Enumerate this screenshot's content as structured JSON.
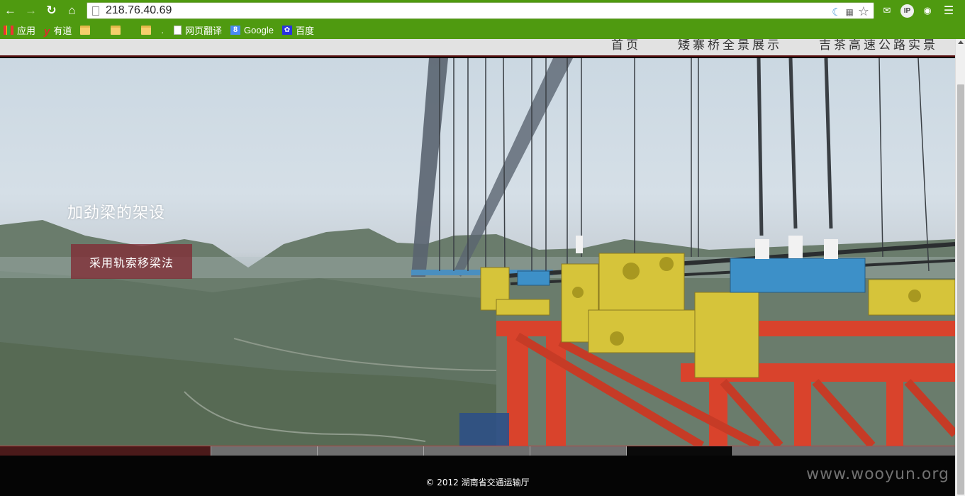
{
  "browser": {
    "url": "218.76.40.69",
    "bookmarks": [
      {
        "label": "应用",
        "icon": "apps-grid-icon"
      },
      {
        "label": "有道",
        "icon": "youdao-icon"
      },
      {
        "label": "",
        "icon": "folder-icon"
      },
      {
        "label": "",
        "icon": "folder-icon"
      },
      {
        "label": ".",
        "icon": "folder-icon"
      },
      {
        "label": "网页翻译",
        "icon": "page-icon"
      },
      {
        "label": "Google",
        "icon": "google-icon"
      },
      {
        "label": "百度",
        "icon": "baidu-icon"
      }
    ]
  },
  "site": {
    "nav": [
      "首页",
      "矮寨桥全景展示",
      "吉茶高速公路实景"
    ],
    "slide": {
      "title": "加劲梁的架设",
      "button_label": "采用轨索移梁法"
    },
    "pager": {
      "count": 7,
      "active_index": 5
    },
    "footer": {
      "copyright": "© 2012 湖南省交通运输厅",
      "watermark": "www.wooyun.org"
    }
  },
  "colors": {
    "browser_green": "#4f9a10",
    "caption_button": "#803038",
    "bridge_red": "#d9432c",
    "clamp_yellow": "#d6c43a",
    "saddle_blue": "#3d90c8"
  }
}
